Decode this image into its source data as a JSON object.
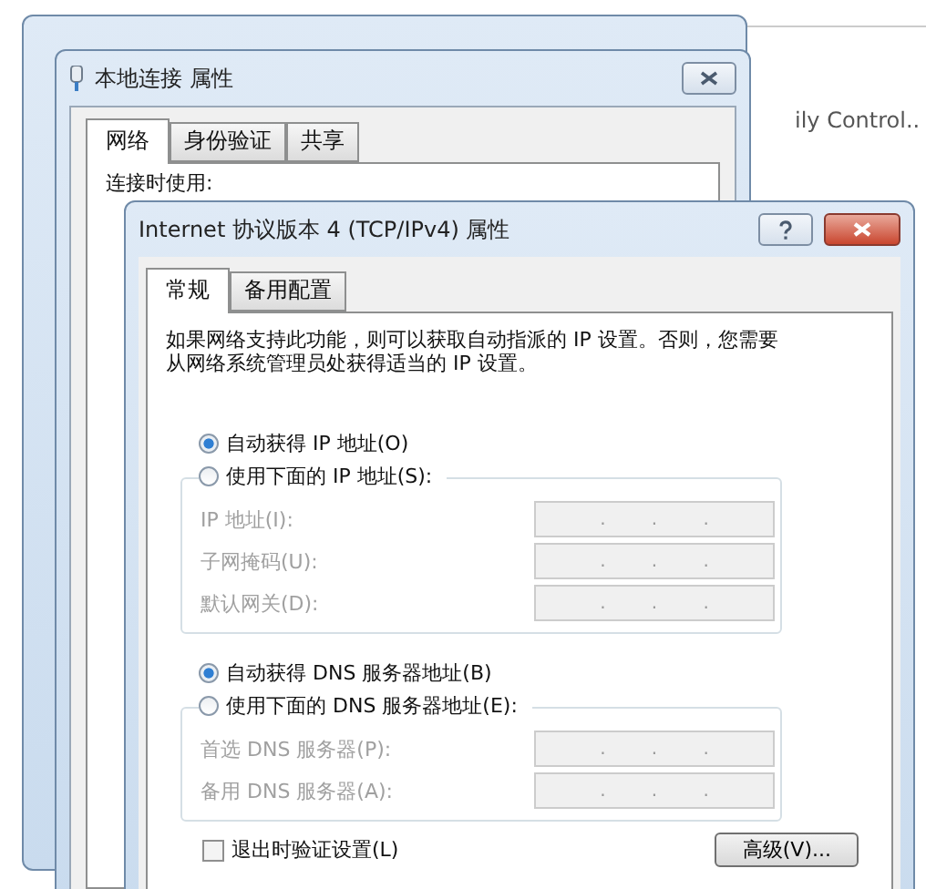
{
  "backdrop_text": "ily Control..",
  "properties_window": {
    "title": "本地连接 属性",
    "tabs": [
      {
        "label": "网络",
        "selected": true
      },
      {
        "label": "身份验证",
        "selected": false
      },
      {
        "label": "共享",
        "selected": false
      }
    ],
    "connect_using_label": "连接时使用:"
  },
  "dialog": {
    "title": "Internet 协议版本 4 (TCP/IPv4) 属性",
    "tabs": [
      {
        "label": "常规",
        "selected": true
      },
      {
        "label": "备用配置",
        "selected": false
      }
    ],
    "description": "如果网络支持此功能，则可以获取自动指派的 IP 设置。否则，您需要从网络系统管理员处获得适当的 IP 设置。",
    "ip_options": [
      {
        "label": "自动获得 IP 地址(O)",
        "selected": true
      },
      {
        "label": "使用下面的 IP 地址(S):",
        "selected": false
      }
    ],
    "ip_fields": [
      {
        "label": "IP 地址(I):",
        "disabled": true,
        "dots": [
          ".",
          ".",
          "."
        ]
      },
      {
        "label": "子网掩码(U):",
        "disabled": true,
        "dots": [
          ".",
          ".",
          "."
        ]
      },
      {
        "label": "默认网关(D):",
        "disabled": true,
        "dots": [
          ".",
          ".",
          "."
        ]
      }
    ],
    "dns_options": [
      {
        "label": "自动获得 DNS 服务器地址(B)",
        "selected": true
      },
      {
        "label": "使用下面的 DNS 服务器地址(E):",
        "selected": false
      }
    ],
    "dns_fields": [
      {
        "label": "首选 DNS 服务器(P):",
        "disabled": true,
        "dots": [
          ".",
          ".",
          "."
        ]
      },
      {
        "label": "备用 DNS 服务器(A):",
        "disabled": true,
        "dots": [
          ".",
          ".",
          "."
        ]
      }
    ],
    "validate_checkbox": {
      "label": "退出时验证设置(L)",
      "checked": false
    },
    "advanced_button": "高级(V)..."
  }
}
